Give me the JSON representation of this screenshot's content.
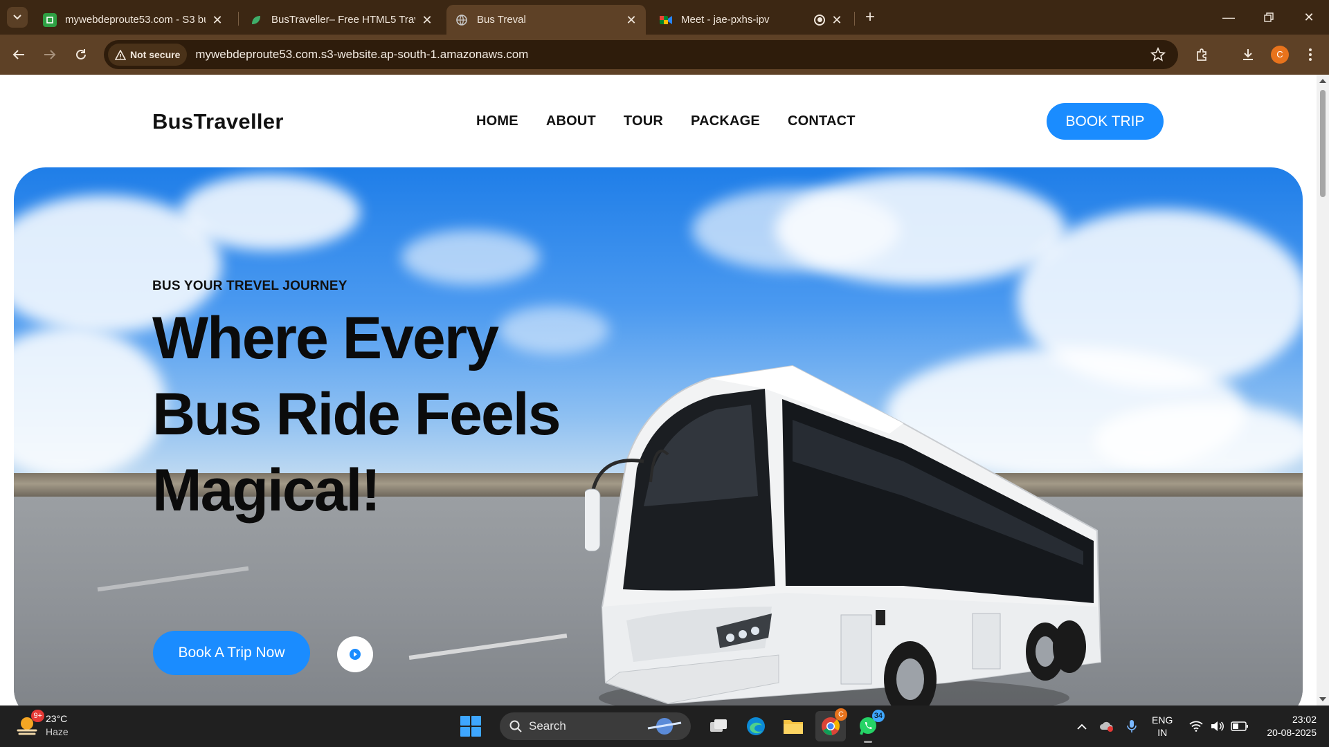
{
  "browser": {
    "tabs": [
      {
        "title": "mywebdeproute53.com - S3 bu",
        "active": false,
        "fav_color": "#2ea043"
      },
      {
        "title": "BusTraveller– Free HTML5 Trave",
        "active": false,
        "fav_color": "#3fae6a"
      },
      {
        "title": "Bus Treval",
        "active": true,
        "fav_color": "#c9c9c9"
      },
      {
        "title": "Meet - jae-pxhs-ipv",
        "active": false,
        "fav_color": "#00832d"
      }
    ],
    "security_label": "Not secure",
    "url": "mywebdeproute53.com.s3-website.ap-south-1.amazonaws.com",
    "profile_initial": "C"
  },
  "site": {
    "logo": "BusTraveller",
    "nav": [
      "HOME",
      "ABOUT",
      "TOUR",
      "PACKAGE",
      "CONTACT"
    ],
    "book_trip": "BOOK TRIP",
    "hero": {
      "eyebrow": "BUS YOUR TREVEL JOURNEY",
      "title": "Where Every Bus Ride Feels Magical!",
      "cta": "Book A Trip Now"
    },
    "accent": "#1a8cff"
  },
  "taskbar": {
    "weather_temp": "23°C",
    "weather_desc": "Haze",
    "weather_badge": "9+",
    "search_label": "Search",
    "whatsapp_badge": "34",
    "chrome_badge": "C",
    "lang_top": "ENG",
    "lang_bottom": "IN",
    "time": "23:02",
    "date": "20-08-2025"
  }
}
